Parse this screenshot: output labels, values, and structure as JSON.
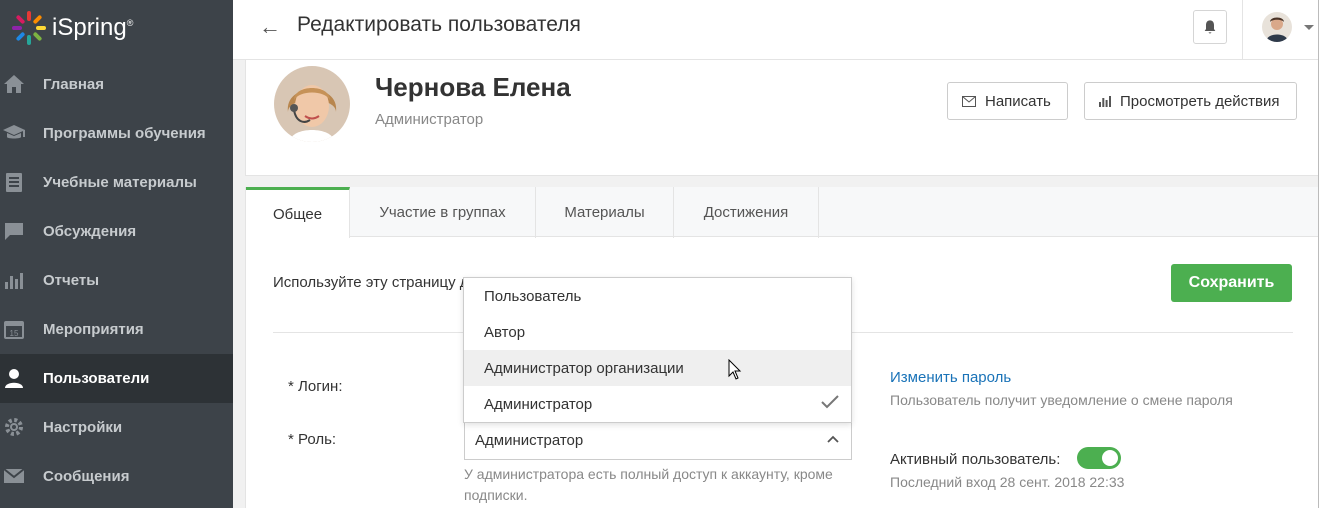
{
  "app": {
    "logo_text": "iSpring",
    "logo_mark": "®"
  },
  "sidebar": {
    "items": [
      {
        "label": "Главная",
        "icon": "home-icon"
      },
      {
        "label": "Программы обучения",
        "icon": "graduation-cap-icon"
      },
      {
        "label": "Учебные материалы",
        "icon": "book-icon"
      },
      {
        "label": "Обсуждения",
        "icon": "chat-icon"
      },
      {
        "label": "Отчеты",
        "icon": "bar-chart-icon"
      },
      {
        "label": "Мероприятия",
        "icon": "calendar-icon"
      },
      {
        "label": "Пользователи",
        "icon": "user-icon",
        "active": true
      },
      {
        "label": "Настройки",
        "icon": "gear-icon"
      },
      {
        "label": "Сообщения",
        "icon": "envelope-icon"
      }
    ]
  },
  "header": {
    "title": "Редактировать пользователя"
  },
  "profile": {
    "name": "Чернова Елена",
    "role": "Администратор",
    "write_label": "Написать",
    "view_actions_label": "Просмотреть действия"
  },
  "tabs": [
    {
      "label": "Общее",
      "active": true
    },
    {
      "label": "Участие в группах"
    },
    {
      "label": "Материалы"
    },
    {
      "label": "Достижения"
    }
  ],
  "form": {
    "intro_text": "Используйте эту страницу для",
    "save_label": "Сохранить",
    "login_label": "* Логин:",
    "role_label": "* Роль:",
    "role_value": "Администратор",
    "role_hint": "У администратора есть полный доступ к аккаунту, кроме подписки.",
    "change_password_link": "Изменить пароль",
    "password_note": "Пользователь получит уведомление о смене пароля",
    "active_user_label": "Активный пользователь:",
    "active_user_enabled": true,
    "last_login": "Последний вход 28 сент. 2018 22:33"
  },
  "role_dropdown": {
    "options": [
      {
        "label": "Пользователь"
      },
      {
        "label": "Автор"
      },
      {
        "label": "Администратор организации",
        "hovered": true
      },
      {
        "label": "Администратор",
        "selected": true
      }
    ]
  },
  "colors": {
    "sidebar_bg": "#3d4349",
    "sidebar_active_bg": "#2d3236",
    "accent_green": "#4caf50",
    "link_blue": "#1a73b8"
  }
}
